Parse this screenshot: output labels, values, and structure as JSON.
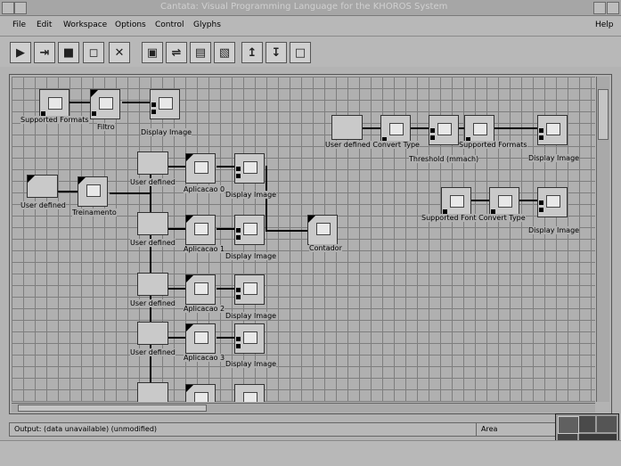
{
  "window": {
    "title": "Cantata: Visual Programming Language for the KHOROS System"
  },
  "menu": {
    "items": [
      "File",
      "Edit",
      "Workspace",
      "Options",
      "Control",
      "Glyphs"
    ],
    "help": "Help"
  },
  "toolbar": {
    "icons": [
      "run-icon",
      "step-icon",
      "stop-icon",
      "open-icon",
      "close-icon",
      "procedure-icon",
      "route-icon",
      "save-icon",
      "save-as-icon",
      "import-icon",
      "export-icon",
      "new-workspace-icon"
    ]
  },
  "nodes": {
    "supported_formats_1": "Supported Formats",
    "filtro": "Filtro",
    "display_image_1": "Display Image",
    "user_defined_1": "User defined",
    "treinamento": "Treinamento",
    "user_defined_2": "User defined",
    "aplicacao_0": "Aplicacao 0",
    "display_image_2": "Display Image",
    "user_defined_3": "User defined",
    "aplicacao_1": "Aplicacao 1",
    "display_image_3": "Display Image",
    "contador": "Contador",
    "user_defined_4": "User defined",
    "aplicacao_2": "Aplicacao 2",
    "display_image_4": "Display Image",
    "user_defined_5": "User defined",
    "aplicacao_3": "Aplicacao 3",
    "display_image_5": "Display Image",
    "user_defined_convert": "User defined Convert Type",
    "threshold": "Threshold (mmach)",
    "supported_formats_2": "Supported Formats",
    "display_image_6": "Display Image",
    "supported_font_convert": "Supported Font Convert Type",
    "display_image_7": "Display Image"
  },
  "status": {
    "output": "Output: (data unavailable) (unmodified)",
    "area_label": "Area"
  }
}
